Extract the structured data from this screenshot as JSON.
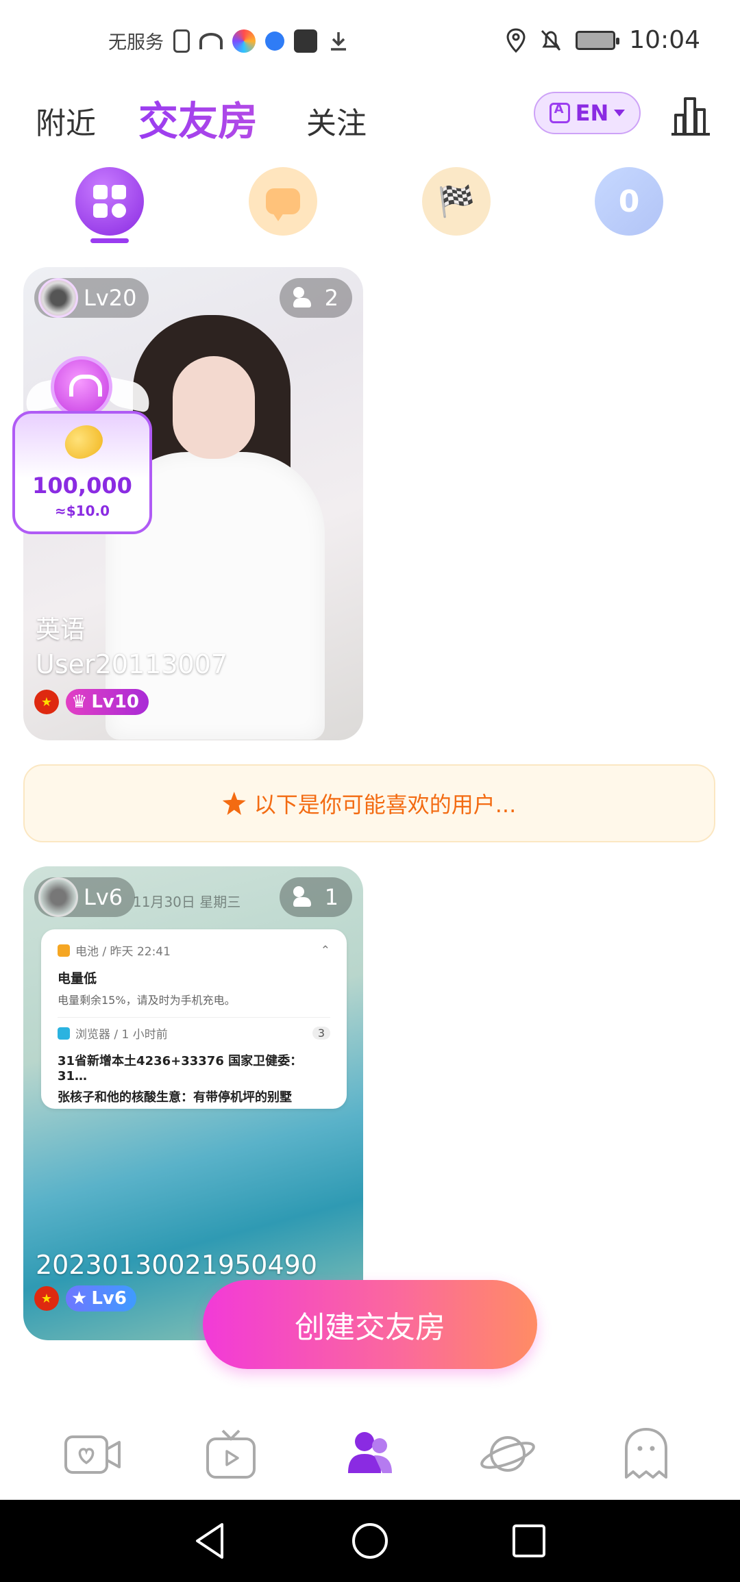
{
  "status_bar": {
    "carrier": "无服务",
    "time": "10:04"
  },
  "top_nav": {
    "tabs": [
      {
        "label": "附近",
        "active": false
      },
      {
        "label": "交友房",
        "active": true
      },
      {
        "label": "关注",
        "active": false
      }
    ],
    "language_button": "EN",
    "accent_color": "#9a3cf0"
  },
  "categories": [
    {
      "icon": "grid-icon",
      "selected": true
    },
    {
      "icon": "chat-bubbles-icon",
      "selected": false
    },
    {
      "icon": "racing-flags-icon",
      "selected": false
    },
    {
      "icon": "number-puzzle-icon",
      "selected": false
    }
  ],
  "rooms": [
    {
      "host_level": "Lv20",
      "member_count": "2",
      "topic": "英语",
      "username": "User20113007",
      "user_tag": "Lv10",
      "gift": {
        "amount": "100,000",
        "usd": "≈$10.0"
      }
    },
    {
      "host_level": "Lv6",
      "member_count": "1",
      "username": "20230130021950490",
      "user_tag": "Lv6",
      "screenshot": {
        "date": "11月30日  星期三",
        "n1_app": "电池 / 昨天 22:41",
        "n1_title": "电量低",
        "n1_body": "电量剩余15%，请及时为手机充电。",
        "n2_app": "浏览器 / 1 小时前",
        "n2_count": "3",
        "n2_line1": "31省新增本土4236+33376  国家卫健委：31…",
        "n2_line2": "张核子和他的核酸生意：有带停机坪的别墅"
      }
    }
  ],
  "suggestion_banner": "以下是你可能喜欢的用户...",
  "create_button": "创建交友房",
  "bottom_nav": [
    {
      "icon": "video-heart-icon",
      "active": false
    },
    {
      "icon": "tv-play-icon",
      "active": false
    },
    {
      "icon": "users-icon",
      "active": true
    },
    {
      "icon": "planet-icon",
      "active": false
    },
    {
      "icon": "ghost-icon",
      "active": false
    }
  ]
}
